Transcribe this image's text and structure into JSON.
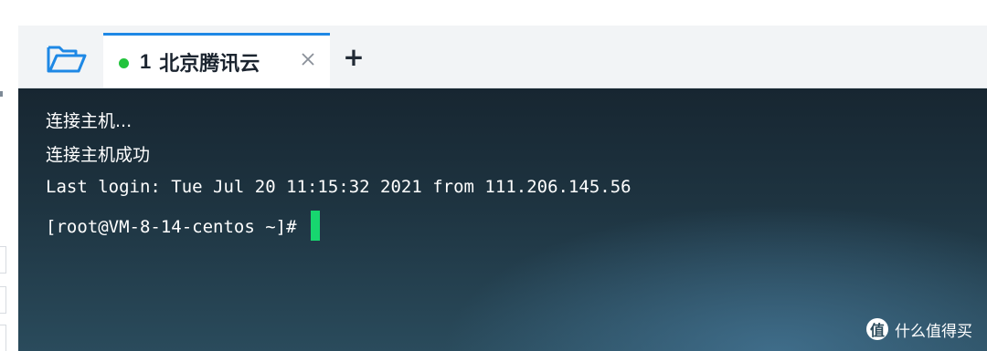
{
  "window": {
    "tab": {
      "number": "1",
      "title": "北京腾讯云",
      "status_color": "#22c33c",
      "close_icon": "close-icon"
    },
    "add_tab_label": "+",
    "open_folder_icon": "folder-open-icon",
    "accent_color": "#1e88e5"
  },
  "terminal": {
    "lines": [
      "连接主机...",
      "连接主机成功",
      "Last login: Tue Jul 20 11:15:32 2021 from 111.206.145.56",
      "[root@VM-8-14-centos ~]# "
    ],
    "cursor_color": "#17d66f"
  },
  "watermark": {
    "badge": "值",
    "text": "什么值得买"
  }
}
